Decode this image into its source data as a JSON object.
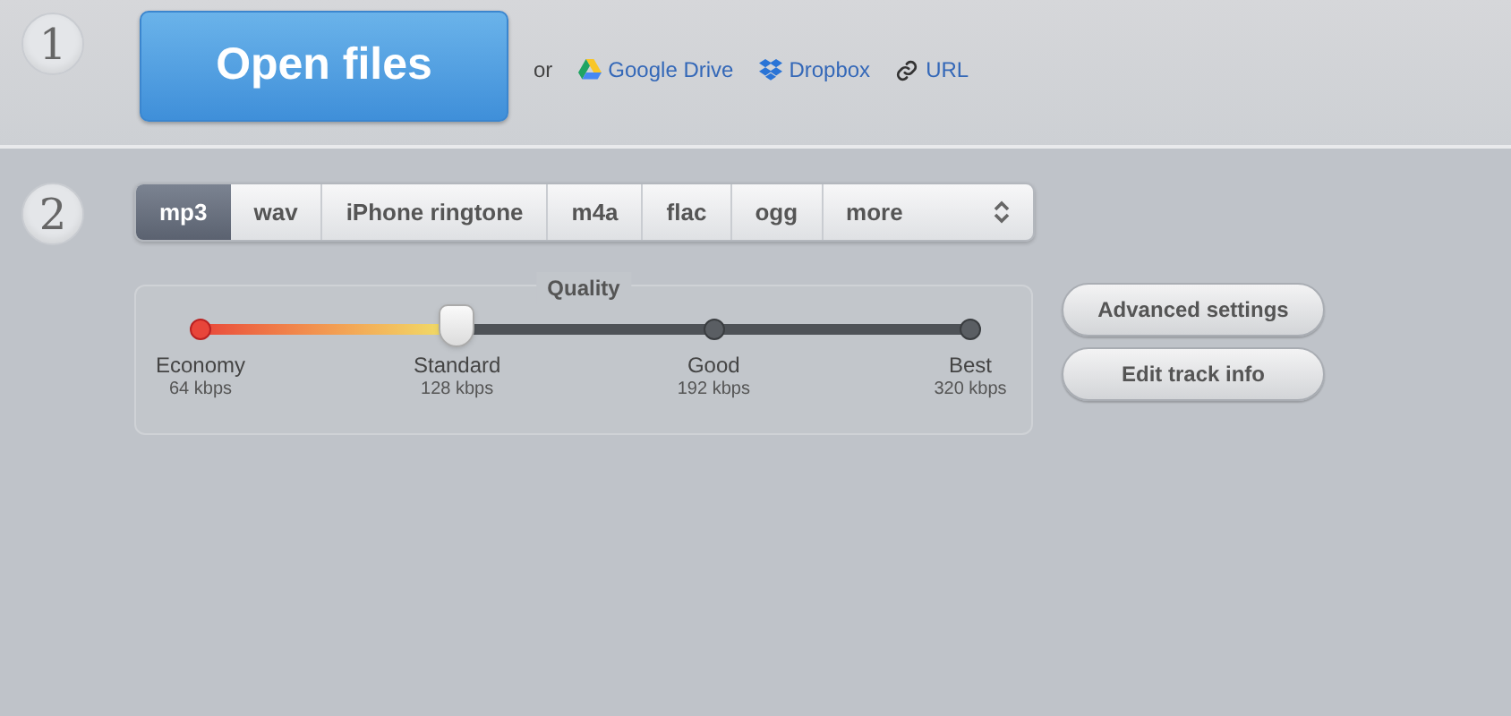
{
  "step_1": {
    "number": "1",
    "open_button": "Open files",
    "or_label": "or",
    "sources": [
      {
        "kind": "drive",
        "label": "Google Drive"
      },
      {
        "kind": "dropbox",
        "label": "Dropbox"
      },
      {
        "kind": "url",
        "label": "URL"
      }
    ]
  },
  "step_2": {
    "number": "2",
    "formats": [
      {
        "label": "mp3",
        "selected": true
      },
      {
        "label": "wav",
        "selected": false
      },
      {
        "label": "iPhone ringtone",
        "selected": false
      },
      {
        "label": "m4a",
        "selected": false
      },
      {
        "label": "flac",
        "selected": false
      },
      {
        "label": "ogg",
        "selected": false
      }
    ],
    "more_select": {
      "value": "more"
    },
    "quality": {
      "title": "Quality",
      "level": 0.3333,
      "stops": [
        {
          "name": "Economy",
          "bitrate": "64 kbps"
        },
        {
          "name": "Standard",
          "bitrate": "128 kbps"
        },
        {
          "name": "Good",
          "bitrate": "192 kbps"
        },
        {
          "name": "Best",
          "bitrate": "320 kbps"
        }
      ]
    },
    "buttons": [
      "Advanced settings",
      "Edit track info"
    ]
  }
}
